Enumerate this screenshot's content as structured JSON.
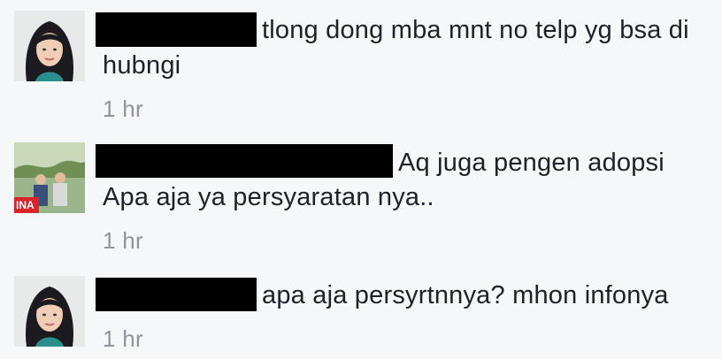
{
  "comments": [
    {
      "avatar": "woman-selfie-avatar",
      "line1": "tlong dong mba mnt no telp yg bsa di",
      "line2": "hubngi",
      "time": "1 hr"
    },
    {
      "avatar": "group-photo-avatar",
      "badge": "INA",
      "line1": "Aq juga pengen adopsi",
      "line2": "Apa aja ya persyaratan nya..",
      "time": "1 hr"
    },
    {
      "avatar": "woman-selfie-avatar",
      "line1": "apa aja persyrtnnya? mhon infonya",
      "time": "1 hr"
    }
  ],
  "colors": {
    "background": "#f6f7f9",
    "text": "#1d2129",
    "timestamp": "#90949c",
    "redaction": "#000000",
    "badge": "#d8232a"
  }
}
